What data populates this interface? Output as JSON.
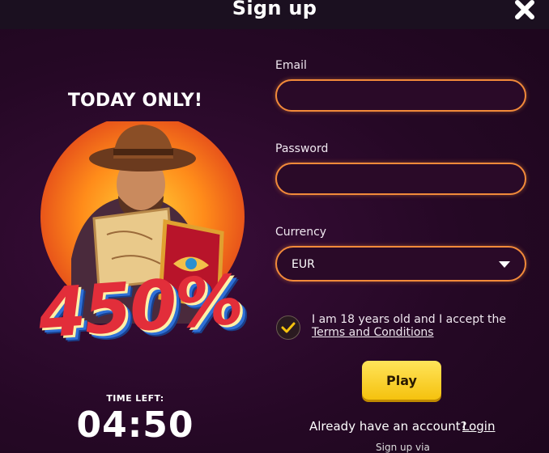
{
  "header": {
    "title": "Sign up",
    "close_icon": "close-icon"
  },
  "promo": {
    "headline": "TODAY ONLY!",
    "bonus": "450%",
    "time_left_label": "TIME LEFT:",
    "timer": "04:50"
  },
  "form": {
    "email_label": "Email",
    "email_value": "",
    "password_label": "Password",
    "password_value": "",
    "currency_label": "Currency",
    "currency_value": "EUR",
    "terms_checked": true,
    "terms_text": "I am 18 years old and I accept the",
    "terms_link": "Terms and Conditions",
    "play_button": "Play",
    "account_prompt": "Already have an account?",
    "login_link": "Login",
    "signup_via": "Sign up via"
  },
  "colors": {
    "accent": "#f28a3a",
    "button": "#f5c20e",
    "background": "#250825",
    "header": "#1b1020"
  }
}
